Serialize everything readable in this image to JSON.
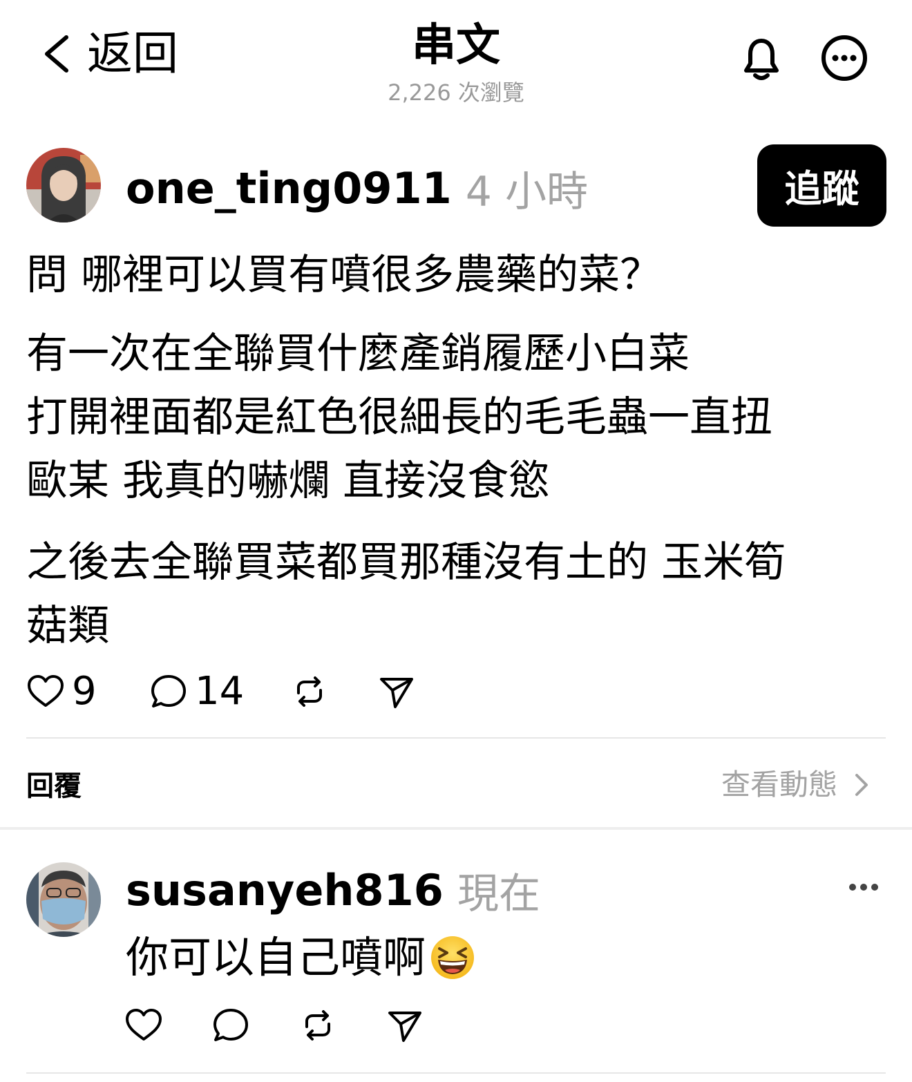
{
  "header": {
    "back_label": "返回",
    "title": "串文",
    "views": "2,226 次瀏覽"
  },
  "post": {
    "username": "one_ting0911",
    "time": "4 小時",
    "follow_label": "追蹤",
    "lines": [
      "問 哪裡可以買有噴很多農藥的菜？",
      "有一次在全聯買什麼產銷履歷小白菜",
      "打開裡面都是紅色很細長的毛毛蟲一直扭",
      "歐某 我真的嚇爛 直接沒食慾",
      "之後去全聯買菜都買那種沒有土的 玉米筍",
      "菇類"
    ],
    "likes": "9",
    "comments": "14"
  },
  "replies_section": {
    "label": "回覆",
    "view_activity": "查看動態"
  },
  "reply": {
    "username": "susanyeh816",
    "time": "現在",
    "text": "你可以自己噴啊",
    "emoji": "grinning-squinting-face-emoji"
  },
  "icons": {
    "back": "chevron-left-icon",
    "bell": "bell-icon",
    "more": "more-circle-icon",
    "like": "heart-icon",
    "comment": "comment-icon",
    "repost": "repost-icon",
    "share": "send-icon"
  }
}
